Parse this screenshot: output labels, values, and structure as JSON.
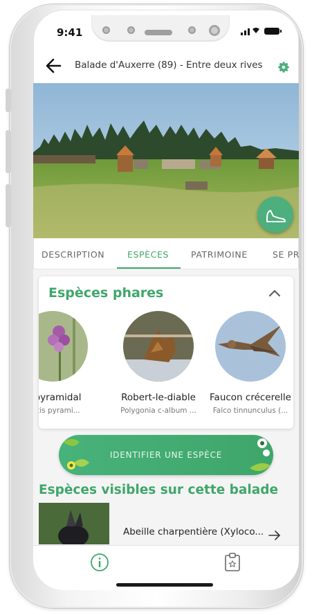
{
  "status": {
    "time": "9:41",
    "icons": "▎▎▎ ◠ ▭"
  },
  "header": {
    "title": "Balade d'Auxerre (89) - Entre deux rives"
  },
  "tabs": [
    {
      "label": "DESCRIPTION",
      "active": false
    },
    {
      "label": "ESPÈCES",
      "active": true
    },
    {
      "label": "PATRIMOINE",
      "active": false
    },
    {
      "label": "SE PR",
      "active": false
    }
  ],
  "featured": {
    "title": "Espèces phares",
    "species": [
      {
        "name": "is pyramidal",
        "latin": "mptis pyrami..."
      },
      {
        "name": "Robert-le-diable",
        "latin": "Polygonia c-album ..."
      },
      {
        "name": "Faucon crécerelle",
        "latin": "Falco tinnunculus (..."
      }
    ]
  },
  "identify_button": {
    "label": "IDENTIFIER UNE ESPÈCE"
  },
  "visible": {
    "title": "Espèces visibles sur cette balade",
    "items": [
      {
        "label": "Abeille charpentière (Xyloco..."
      }
    ]
  },
  "colors": {
    "accent": "#3fa66a",
    "fab": "#4caf7d"
  },
  "icons": {
    "back": "arrow-left-icon",
    "settings": "gear-icon",
    "walk": "shoe-icon",
    "collapse": "chevron-up-icon",
    "next": "arrow-right-icon",
    "info": "info-icon",
    "clipboard": "clipboard-icon"
  }
}
